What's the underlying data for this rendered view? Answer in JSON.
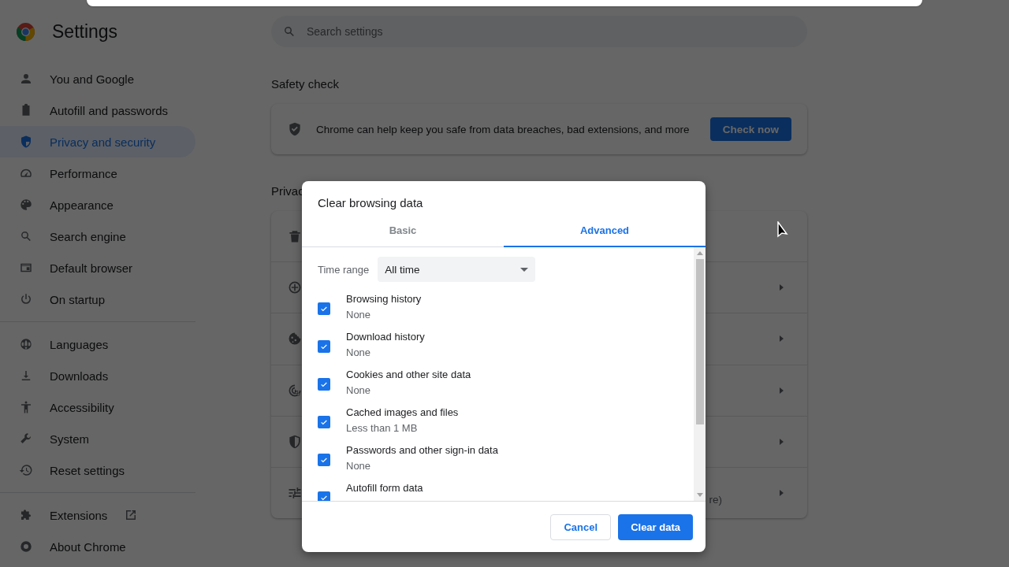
{
  "header": {
    "title": "Settings"
  },
  "search": {
    "placeholder": "Search settings"
  },
  "sidebar": {
    "groups": [
      [
        {
          "label": "You and Google",
          "selected": false
        },
        {
          "label": "Autofill and passwords",
          "selected": false
        },
        {
          "label": "Privacy and security",
          "selected": true
        },
        {
          "label": "Performance",
          "selected": false
        },
        {
          "label": "Appearance",
          "selected": false
        },
        {
          "label": "Search engine",
          "selected": false
        },
        {
          "label": "Default browser",
          "selected": false
        },
        {
          "label": "On startup",
          "selected": false
        }
      ],
      [
        {
          "label": "Languages",
          "selected": false
        },
        {
          "label": "Downloads",
          "selected": false
        },
        {
          "label": "Accessibility",
          "selected": false
        },
        {
          "label": "System",
          "selected": false
        },
        {
          "label": "Reset settings",
          "selected": false
        }
      ],
      [
        {
          "label": "Extensions",
          "selected": false,
          "external": true
        },
        {
          "label": "About Chrome",
          "selected": false
        }
      ]
    ]
  },
  "safety_check": {
    "heading": "Safety check",
    "text": "Chrome can help keep you safe from data breaches, bad extensions, and more",
    "button": "Check now"
  },
  "privacy": {
    "heading": "Privac",
    "fragment": "re)"
  },
  "dialog": {
    "title": "Clear browsing data",
    "tabs": [
      {
        "label": "Basic",
        "selected": false
      },
      {
        "label": "Advanced",
        "selected": true
      }
    ],
    "time_range": {
      "label": "Time range",
      "value": "All time"
    },
    "items": [
      {
        "label": "Browsing history",
        "detail": "None",
        "checked": true
      },
      {
        "label": "Download history",
        "detail": "None",
        "checked": true
      },
      {
        "label": "Cookies and other site data",
        "detail": "None",
        "checked": true
      },
      {
        "label": "Cached images and files",
        "detail": "Less than 1 MB",
        "checked": true
      },
      {
        "label": "Passwords and other sign-in data",
        "detail": "None",
        "checked": true
      },
      {
        "label": "Autofill form data",
        "checked": true
      }
    ],
    "buttons": [
      {
        "label": "Cancel",
        "kind": "secondary"
      },
      {
        "label": "Clear data",
        "kind": "primary"
      }
    ]
  }
}
